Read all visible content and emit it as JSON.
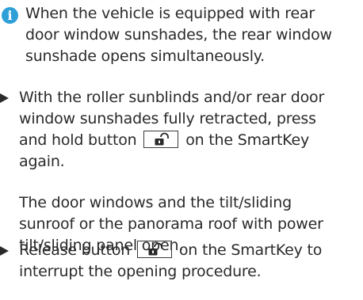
{
  "note": {
    "icon": "info-icon",
    "icon_glyph": "i",
    "line1": "When the vehicle is equipped with rear",
    "line2": "door window sunshades, the rear window",
    "line3": "sunshade opens simultaneously."
  },
  "step1": {
    "line1": "With the roller sunblinds and/or rear door",
    "line2": "window sunshades fully retracted, press",
    "line3_before": "and hold button",
    "line3_after": "on the SmartKey",
    "line4": "again.",
    "button_icon": "unlock-icon"
  },
  "result": {
    "line1": "The door windows and the tilt/sliding",
    "line2": "sunroof or the panorama roof with power",
    "line3": "tilt/sliding panel open."
  },
  "step2": {
    "line1_before": "Release button",
    "line1_after": "on the SmartKey to",
    "line2": "interrupt the opening procedure.",
    "button_icon": "unlock-icon"
  },
  "colors": {
    "info_icon": "#2f9fd8",
    "text": "#2a2a2a"
  }
}
